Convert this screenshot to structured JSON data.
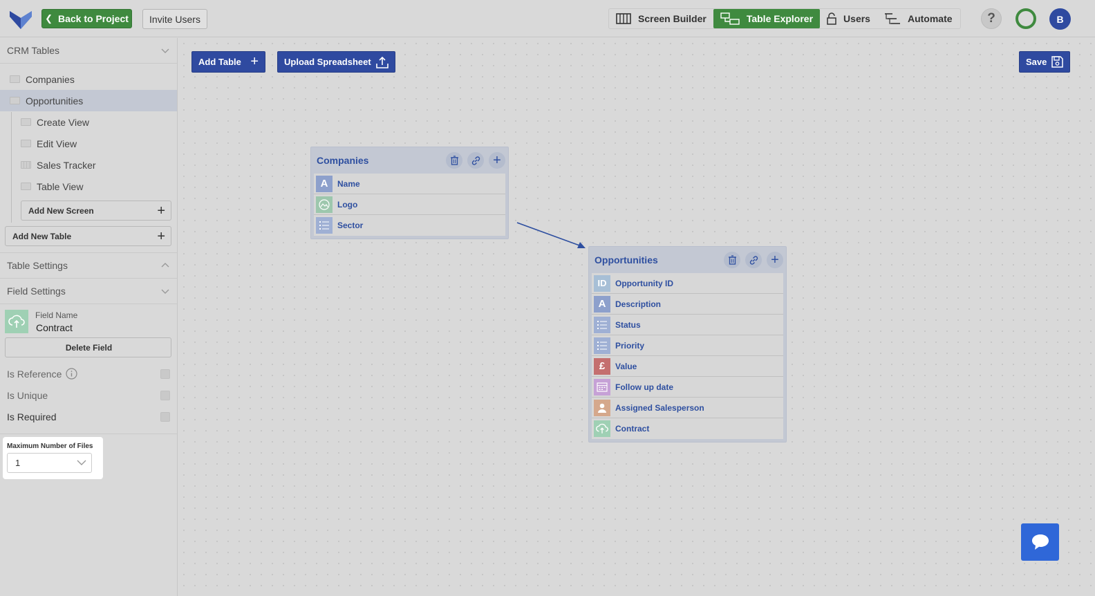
{
  "topbar": {
    "back_label": "Back to Project",
    "invite_label": "Invite Users",
    "nav": [
      {
        "label": "Screen Builder",
        "icon": "columns-icon",
        "active": false
      },
      {
        "label": "Table Explorer",
        "icon": "table-explorer-icon",
        "active": true
      },
      {
        "label": "Users",
        "icon": "lock-icon",
        "active": false
      },
      {
        "label": "Automate",
        "icon": "automate-icon",
        "active": false
      }
    ],
    "help_label": "?",
    "avatar_initial": "B",
    "colors": {
      "green": "#3f8a3f",
      "blue": "#2f4aa0"
    }
  },
  "sidebar": {
    "crm_title": "CRM Tables",
    "tables": [
      "Companies",
      "Opportunities"
    ],
    "screens": [
      "Create View",
      "Edit View",
      "Sales Tracker",
      "Table View"
    ],
    "add_screen_label": "Add New Screen",
    "add_table_label": "Add New Table",
    "table_settings_title": "Table Settings",
    "field_settings_title": "Field Settings",
    "field_name_label": "Field Name",
    "field_name_value": "Contract",
    "delete_field_label": "Delete Field",
    "is_reference_label": "Is Reference",
    "is_unique_label": "Is Unique",
    "is_required_label": "Is Required",
    "max_files_label": "Maximum Number of Files",
    "max_files_value": "1"
  },
  "canvas": {
    "add_table_label": "Add Table",
    "upload_label": "Upload Spreadsheet",
    "save_label": "Save",
    "companies": {
      "title": "Companies",
      "fields": [
        {
          "name": "Name",
          "icon": "text-icon",
          "glyph": "A",
          "color": "#8da0cc"
        },
        {
          "name": "Logo",
          "icon": "image-icon",
          "glyph": "",
          "color": "#9dc7ad"
        },
        {
          "name": "Sector",
          "icon": "list-icon",
          "glyph": "",
          "color": "#9fb0d4"
        }
      ]
    },
    "opportunities": {
      "title": "Opportunities",
      "fields": [
        {
          "name": "Opportunity ID",
          "icon": "id-icon",
          "glyph": "ID",
          "color": "#a7bfd6"
        },
        {
          "name": "Description",
          "icon": "text-icon",
          "glyph": "A",
          "color": "#8da0cc"
        },
        {
          "name": "Status",
          "icon": "list-icon",
          "glyph": "",
          "color": "#9fb0d4"
        },
        {
          "name": "Priority",
          "icon": "list-icon",
          "glyph": "",
          "color": "#9fb0d4"
        },
        {
          "name": "Value",
          "icon": "pound-icon",
          "glyph": "£",
          "color": "#c46f6f"
        },
        {
          "name": "Follow up date",
          "icon": "calendar-icon",
          "glyph": "",
          "color": "#c6a1d6"
        },
        {
          "name": "Assigned Salesperson",
          "icon": "person-icon",
          "glyph": "",
          "color": "#d5a88c"
        },
        {
          "name": "Contract",
          "icon": "upload-icon",
          "glyph": "",
          "color": "#9fd0b4"
        }
      ]
    }
  }
}
